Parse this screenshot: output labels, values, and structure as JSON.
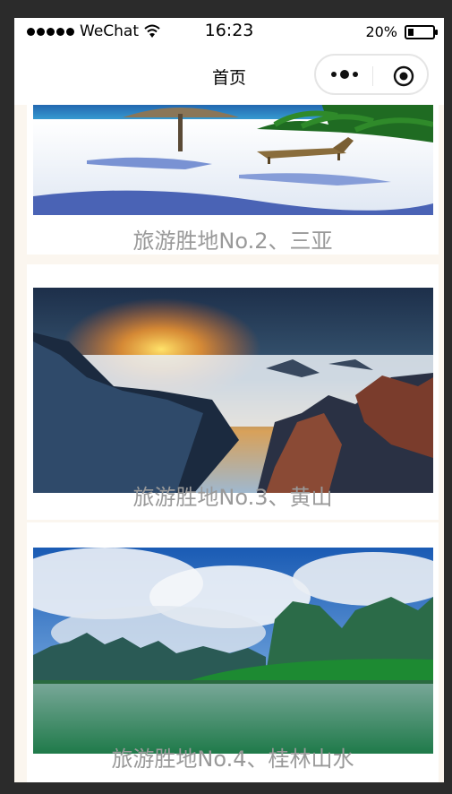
{
  "status_bar": {
    "carrier": "WeChat",
    "time": "16:23",
    "battery": "20%"
  },
  "nav": {
    "title": "首页"
  },
  "cards": [
    {
      "caption": "旅游胜地No.2、三亚"
    },
    {
      "caption": "旅游胜地No.3、黄山"
    },
    {
      "caption": "旅游胜地No.4、桂林山水"
    }
  ]
}
